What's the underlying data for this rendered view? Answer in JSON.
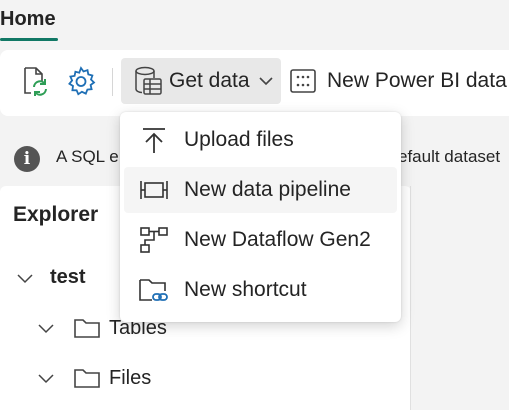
{
  "header": {
    "tab_home": "Home"
  },
  "toolbar": {
    "refresh_icon": "refresh-document-icon",
    "settings_icon": "gear-icon",
    "get_data_label": "Get data",
    "get_data_icon": "database-table-icon",
    "new_pbi_label": "New Power BI data",
    "new_pbi_icon": "dataset-grid-icon"
  },
  "infobar": {
    "text_left": "A SQL e",
    "text_right": "efault dataset"
  },
  "explorer": {
    "title": "Explorer",
    "tree": [
      {
        "label": "test",
        "bold": true
      },
      {
        "label": "Tables",
        "bold": false
      },
      {
        "label": "Files",
        "bold": false
      }
    ]
  },
  "dropdown": {
    "items": [
      {
        "label": "Upload files",
        "icon": "upload-icon"
      },
      {
        "label": "New data pipeline",
        "icon": "pipeline-icon"
      },
      {
        "label": "New Dataflow Gen2",
        "icon": "dataflow-icon"
      },
      {
        "label": "New shortcut",
        "icon": "folder-link-icon"
      }
    ]
  },
  "colors": {
    "accent": "#117865",
    "icon_blue": "#1F6FB5",
    "icon_green": "#2E9E56"
  }
}
